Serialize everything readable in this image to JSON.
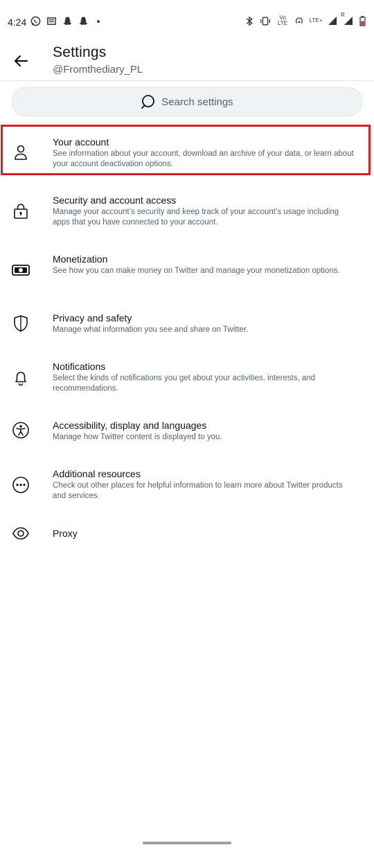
{
  "status_bar": {
    "time": "4:24",
    "left_icons": [
      "whatsapp-icon",
      "news-icon",
      "snapchat-icon",
      "snapchat-icon",
      "dot-icon"
    ],
    "right_labels": {
      "volte": "Vo LTE",
      "lte": "LTE+",
      "roaming": "R"
    }
  },
  "header": {
    "title": "Settings",
    "username": "@Fromthediary_PL"
  },
  "search": {
    "placeholder": "Search settings"
  },
  "settings": [
    {
      "title": "Your account",
      "description": "See information about your account, download an archive of your data, or learn about your account deactivation options.",
      "icon": "person-icon",
      "highlighted": true
    },
    {
      "title": "Security and account access",
      "description": "Manage your account’s security and keep track of your account’s usage including apps that you have connected to your account.",
      "icon": "lock-icon"
    },
    {
      "title": "Monetization",
      "description": "See how you can make money on Twitter and manage your monetization options.",
      "icon": "money-icon"
    },
    {
      "title": "Privacy and safety",
      "description": "Manage what information you see and share on Twitter.",
      "icon": "shield-icon"
    },
    {
      "title": "Notifications",
      "description": "Select the kinds of notifications you get about your activities, interests, and recommendations.",
      "icon": "bell-icon"
    },
    {
      "title": "Accessibility, display and languages",
      "description": "Manage how Twitter content is displayed to you.",
      "icon": "accessibility-icon"
    },
    {
      "title": "Additional resources",
      "description": "Check out other places for helpful information to learn more about Twitter products and services.",
      "icon": "more-icon"
    },
    {
      "title": "Proxy",
      "description": "",
      "icon": "eye-icon"
    }
  ],
  "colors": {
    "highlight_border": "#d7201f",
    "text_primary": "#0f1419",
    "text_secondary": "#536471",
    "search_bg": "#eff3f4"
  }
}
